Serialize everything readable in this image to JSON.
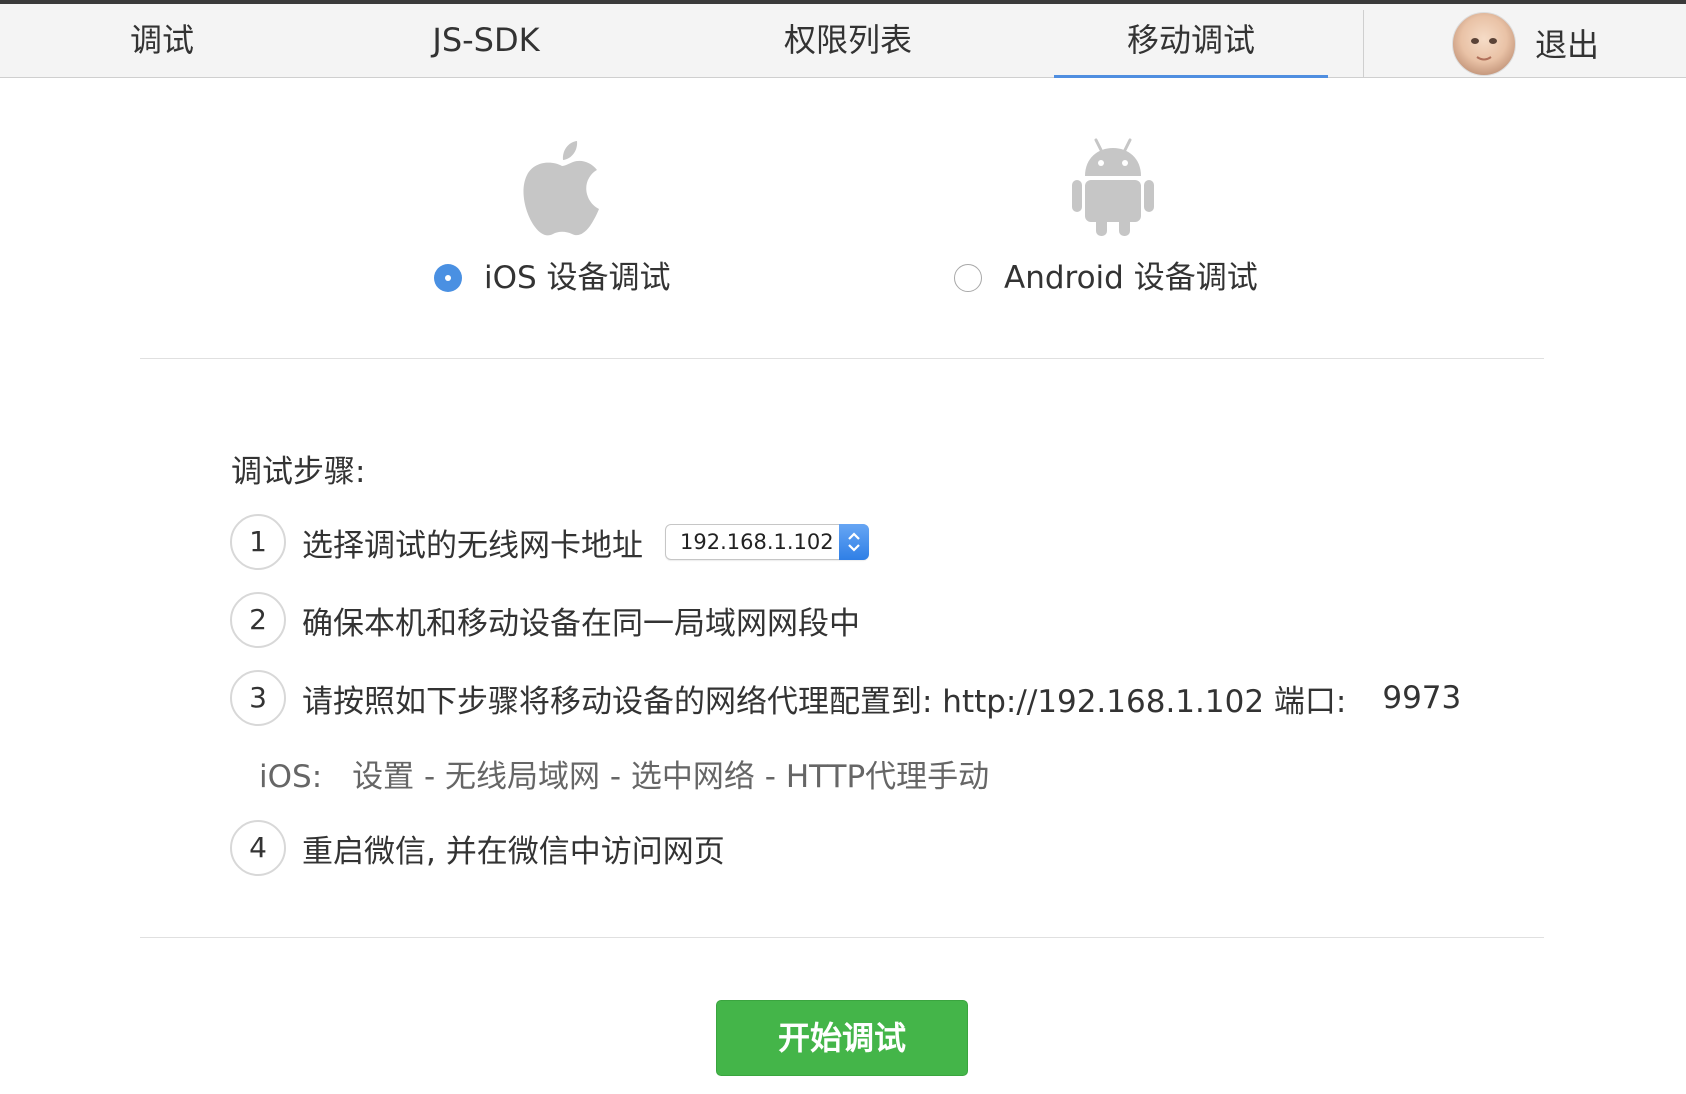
{
  "nav": {
    "tabs": [
      {
        "label": "调试"
      },
      {
        "label": "JS-SDK"
      },
      {
        "label": "权限列表"
      },
      {
        "label": "移动调试",
        "active": true
      }
    ],
    "logout": "退出",
    "active_color": "#4f8ee0"
  },
  "platforms": {
    "ios": {
      "label": "iOS 设备调试",
      "icon": "apple-icon",
      "selected": true
    },
    "android": {
      "label": "Android 设备调试",
      "icon": "android-icon",
      "selected": false
    }
  },
  "steps": {
    "title": "调试步骤:",
    "items": [
      {
        "num": "1",
        "text": "选择调试的无线网卡地址"
      },
      {
        "num": "2",
        "text": "确保本机和移动设备在同一局域网网段中"
      },
      {
        "num": "3",
        "text": "请按照如下步骤将移动设备的网络代理配置到: http://192.168.1.102 端口:",
        "port": "9973"
      },
      {
        "num": "4",
        "text": "重启微信, 并在微信中访问网页"
      }
    ],
    "ip_select": {
      "value": "192.168.1.102"
    },
    "ios_path": {
      "prefix": "iOS:",
      "path": "设置 - 无线局域网 - 选中网络 - HTTP代理手动"
    }
  },
  "start_button": {
    "label": "开始调试",
    "color": "#44b549"
  }
}
